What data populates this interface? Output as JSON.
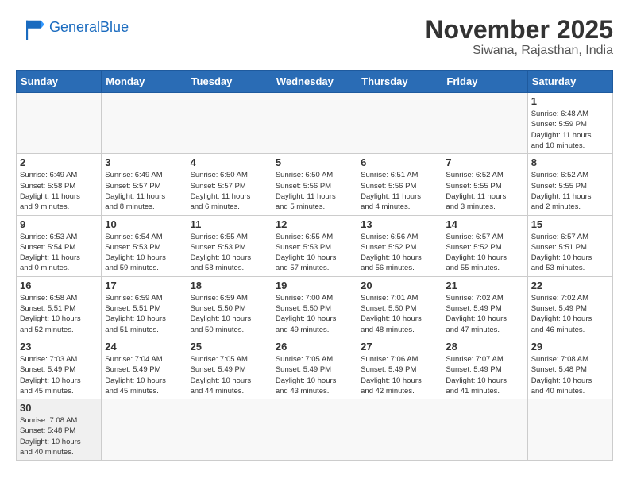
{
  "header": {
    "logo_line1": "General",
    "logo_line2": "Blue",
    "month": "November 2025",
    "location": "Siwana, Rajasthan, India"
  },
  "weekdays": [
    "Sunday",
    "Monday",
    "Tuesday",
    "Wednesday",
    "Thursday",
    "Friday",
    "Saturday"
  ],
  "weeks": [
    [
      {
        "day": "",
        "info": ""
      },
      {
        "day": "",
        "info": ""
      },
      {
        "day": "",
        "info": ""
      },
      {
        "day": "",
        "info": ""
      },
      {
        "day": "",
        "info": ""
      },
      {
        "day": "",
        "info": ""
      },
      {
        "day": "1",
        "info": "Sunrise: 6:48 AM\nSunset: 5:59 PM\nDaylight: 11 hours\nand 10 minutes."
      }
    ],
    [
      {
        "day": "2",
        "info": "Sunrise: 6:49 AM\nSunset: 5:58 PM\nDaylight: 11 hours\nand 9 minutes."
      },
      {
        "day": "3",
        "info": "Sunrise: 6:49 AM\nSunset: 5:57 PM\nDaylight: 11 hours\nand 8 minutes."
      },
      {
        "day": "4",
        "info": "Sunrise: 6:50 AM\nSunset: 5:57 PM\nDaylight: 11 hours\nand 6 minutes."
      },
      {
        "day": "5",
        "info": "Sunrise: 6:50 AM\nSunset: 5:56 PM\nDaylight: 11 hours\nand 5 minutes."
      },
      {
        "day": "6",
        "info": "Sunrise: 6:51 AM\nSunset: 5:56 PM\nDaylight: 11 hours\nand 4 minutes."
      },
      {
        "day": "7",
        "info": "Sunrise: 6:52 AM\nSunset: 5:55 PM\nDaylight: 11 hours\nand 3 minutes."
      },
      {
        "day": "8",
        "info": "Sunrise: 6:52 AM\nSunset: 5:55 PM\nDaylight: 11 hours\nand 2 minutes."
      }
    ],
    [
      {
        "day": "9",
        "info": "Sunrise: 6:53 AM\nSunset: 5:54 PM\nDaylight: 11 hours\nand 0 minutes."
      },
      {
        "day": "10",
        "info": "Sunrise: 6:54 AM\nSunset: 5:53 PM\nDaylight: 10 hours\nand 59 minutes."
      },
      {
        "day": "11",
        "info": "Sunrise: 6:55 AM\nSunset: 5:53 PM\nDaylight: 10 hours\nand 58 minutes."
      },
      {
        "day": "12",
        "info": "Sunrise: 6:55 AM\nSunset: 5:53 PM\nDaylight: 10 hours\nand 57 minutes."
      },
      {
        "day": "13",
        "info": "Sunrise: 6:56 AM\nSunset: 5:52 PM\nDaylight: 10 hours\nand 56 minutes."
      },
      {
        "day": "14",
        "info": "Sunrise: 6:57 AM\nSunset: 5:52 PM\nDaylight: 10 hours\nand 55 minutes."
      },
      {
        "day": "15",
        "info": "Sunrise: 6:57 AM\nSunset: 5:51 PM\nDaylight: 10 hours\nand 53 minutes."
      }
    ],
    [
      {
        "day": "16",
        "info": "Sunrise: 6:58 AM\nSunset: 5:51 PM\nDaylight: 10 hours\nand 52 minutes."
      },
      {
        "day": "17",
        "info": "Sunrise: 6:59 AM\nSunset: 5:51 PM\nDaylight: 10 hours\nand 51 minutes."
      },
      {
        "day": "18",
        "info": "Sunrise: 6:59 AM\nSunset: 5:50 PM\nDaylight: 10 hours\nand 50 minutes."
      },
      {
        "day": "19",
        "info": "Sunrise: 7:00 AM\nSunset: 5:50 PM\nDaylight: 10 hours\nand 49 minutes."
      },
      {
        "day": "20",
        "info": "Sunrise: 7:01 AM\nSunset: 5:50 PM\nDaylight: 10 hours\nand 48 minutes."
      },
      {
        "day": "21",
        "info": "Sunrise: 7:02 AM\nSunset: 5:49 PM\nDaylight: 10 hours\nand 47 minutes."
      },
      {
        "day": "22",
        "info": "Sunrise: 7:02 AM\nSunset: 5:49 PM\nDaylight: 10 hours\nand 46 minutes."
      }
    ],
    [
      {
        "day": "23",
        "info": "Sunrise: 7:03 AM\nSunset: 5:49 PM\nDaylight: 10 hours\nand 45 minutes."
      },
      {
        "day": "24",
        "info": "Sunrise: 7:04 AM\nSunset: 5:49 PM\nDaylight: 10 hours\nand 45 minutes."
      },
      {
        "day": "25",
        "info": "Sunrise: 7:05 AM\nSunset: 5:49 PM\nDaylight: 10 hours\nand 44 minutes."
      },
      {
        "day": "26",
        "info": "Sunrise: 7:05 AM\nSunset: 5:49 PM\nDaylight: 10 hours\nand 43 minutes."
      },
      {
        "day": "27",
        "info": "Sunrise: 7:06 AM\nSunset: 5:49 PM\nDaylight: 10 hours\nand 42 minutes."
      },
      {
        "day": "28",
        "info": "Sunrise: 7:07 AM\nSunset: 5:49 PM\nDaylight: 10 hours\nand 41 minutes."
      },
      {
        "day": "29",
        "info": "Sunrise: 7:08 AM\nSunset: 5:48 PM\nDaylight: 10 hours\nand 40 minutes."
      }
    ],
    [
      {
        "day": "30",
        "info": "Sunrise: 7:08 AM\nSunset: 5:48 PM\nDaylight: 10 hours\nand 40 minutes."
      },
      {
        "day": "",
        "info": ""
      },
      {
        "day": "",
        "info": ""
      },
      {
        "day": "",
        "info": ""
      },
      {
        "day": "",
        "info": ""
      },
      {
        "day": "",
        "info": ""
      },
      {
        "day": "",
        "info": ""
      }
    ]
  ]
}
